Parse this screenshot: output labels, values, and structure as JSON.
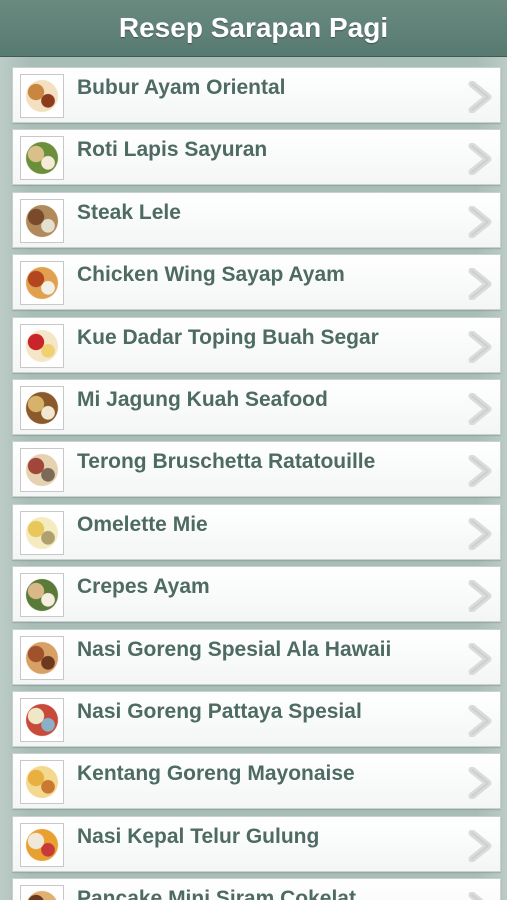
{
  "header": {
    "title": "Resep Sarapan Pagi"
  },
  "recipes": [
    {
      "label": "Bubur Ayam Oriental",
      "icon": "bubur-ayam-thumbnail",
      "colors": [
        "#c9863e",
        "#f2e0c0",
        "#8b3b1e"
      ]
    },
    {
      "label": "Roti Lapis Sayuran",
      "icon": "roti-lapis-thumbnail",
      "colors": [
        "#d9c08a",
        "#6b8f3a",
        "#f5ecd8"
      ]
    },
    {
      "label": "Steak Lele",
      "icon": "steak-lele-thumbnail",
      "colors": [
        "#7a4a2c",
        "#b08a5a",
        "#e4e0d0"
      ]
    },
    {
      "label": "Chicken Wing Sayap Ayam",
      "icon": "chicken-wing-thumbnail",
      "colors": [
        "#b4461f",
        "#e0a050",
        "#f2efe6"
      ]
    },
    {
      "label": "Kue Dadar Toping Buah Segar",
      "icon": "kue-dadar-thumbnail",
      "colors": [
        "#c8242a",
        "#f5e6c8",
        "#f0d070"
      ]
    },
    {
      "label": "Mi Jagung Kuah Seafood",
      "icon": "mi-jagung-thumbnail",
      "colors": [
        "#d7b26a",
        "#8a5a2a",
        "#f2e8d2"
      ]
    },
    {
      "label": "Terong Bruschetta Ratatouille",
      "icon": "terong-bruschetta-thumbnail",
      "colors": [
        "#a0463a",
        "#e6d2b0",
        "#7b6a58"
      ]
    },
    {
      "label": "Omelette Mie",
      "icon": "omelette-mie-thumbnail",
      "colors": [
        "#e8c85a",
        "#f5ebc0",
        "#b0a070"
      ]
    },
    {
      "label": "Crepes Ayam",
      "icon": "crepes-ayam-thumbnail",
      "colors": [
        "#d8b886",
        "#5a7a3a",
        "#f4ede0"
      ]
    },
    {
      "label": "Nasi Goreng Spesial Ala Hawaii",
      "icon": "nasi-goreng-hawaii-thumbnail",
      "colors": [
        "#a0522d",
        "#d9a066",
        "#6b3a1e"
      ]
    },
    {
      "label": "Nasi Goreng Pattaya Spesial",
      "icon": "nasi-goreng-pattaya-thumbnail",
      "colors": [
        "#f0e6c8",
        "#c84a3a",
        "#8ab0c8"
      ]
    },
    {
      "label": "Kentang Goreng Mayonaise",
      "icon": "kentang-goreng-thumbnail",
      "colors": [
        "#e8b040",
        "#f5d890",
        "#c87a30"
      ]
    },
    {
      "label": "Nasi Kepal Telur Gulung",
      "icon": "nasi-kepal-thumbnail",
      "colors": [
        "#f0e8d8",
        "#e8a030",
        "#c83a3a"
      ]
    },
    {
      "label": "Pancake Mini Siram Cokelat",
      "icon": "pancake-mini-thumbnail",
      "colors": [
        "#6a3a1e",
        "#e0b070",
        "#f2e6d0"
      ]
    }
  ]
}
